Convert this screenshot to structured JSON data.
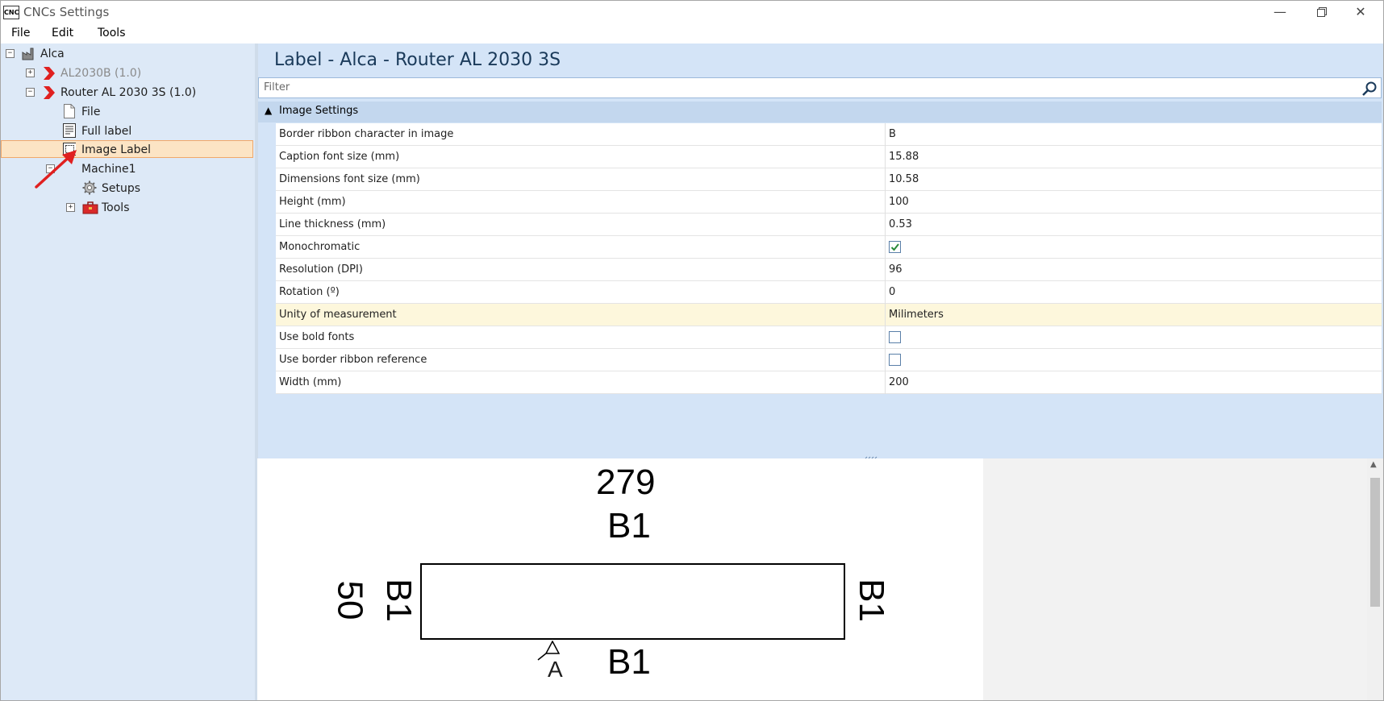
{
  "window": {
    "title": "CNCs Settings",
    "app_icon_text": "CNC"
  },
  "menu": [
    "File",
    "Edit",
    "Tools"
  ],
  "tree": {
    "root": "Alca",
    "items": [
      {
        "label": "AL2030B (1.0)",
        "disabled": true
      },
      {
        "label": "Router AL 2030 3S (1.0)"
      },
      {
        "label": "File"
      },
      {
        "label": "Full label"
      },
      {
        "label": "Image Label",
        "selected": true
      },
      {
        "label": "Machine1"
      },
      {
        "label": "Setups"
      },
      {
        "label": "Tools"
      }
    ]
  },
  "header": {
    "title": "Label - Alca - Router AL 2030 3S"
  },
  "filter": {
    "placeholder": "Filter"
  },
  "category": {
    "label": "Image Settings"
  },
  "properties": [
    {
      "name": "Border ribbon character in image",
      "value": "B"
    },
    {
      "name": "Caption font size (mm)",
      "value": "15.88"
    },
    {
      "name": "Dimensions font size (mm)",
      "value": "10.58"
    },
    {
      "name": "Height (mm)",
      "value": "100"
    },
    {
      "name": "Line thickness (mm)",
      "value": "0.53"
    },
    {
      "name": "Monochromatic",
      "checked": true
    },
    {
      "name": "Resolution (DPI)",
      "value": "96"
    },
    {
      "name": "Rotation (º)",
      "value": "0"
    },
    {
      "name": "Unity of measurement",
      "value": "Milimeters",
      "highlighted": true
    },
    {
      "name": "Use bold fonts",
      "checked": false
    },
    {
      "name": "Use border ribbon reference",
      "checked": false
    },
    {
      "name": "Width (mm)",
      "value": "200"
    }
  ],
  "preview": {
    "length": "279",
    "width": "50",
    "top_ribbon": "B1",
    "bottom_ribbon": "B1",
    "left_ribbon": "B1",
    "right_ribbon": "B1",
    "ref_marker": "A"
  },
  "colors": {
    "tree_bg": "#dde9f7",
    "panel_bg": "#d4e4f7",
    "selection": "#fce4c4",
    "annotation": "#e02020"
  }
}
